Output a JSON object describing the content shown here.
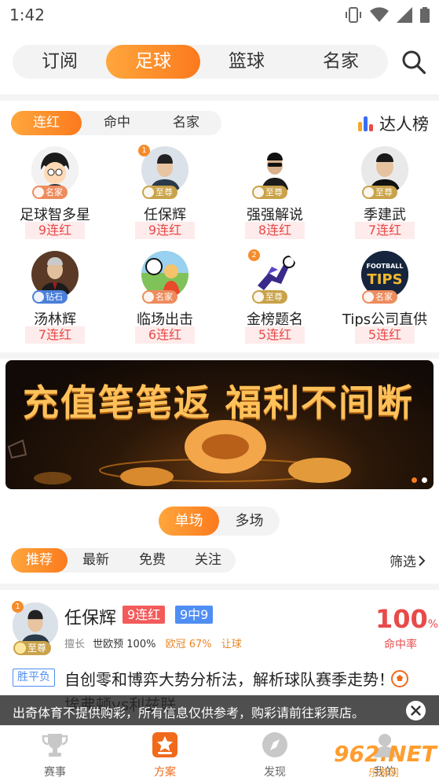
{
  "status_bar": {
    "time": "1:42"
  },
  "top_tabs": [
    {
      "label": "订阅",
      "active": false
    },
    {
      "label": "足球",
      "active": true
    },
    {
      "label": "篮球",
      "active": false
    },
    {
      "label": "名家",
      "active": false
    }
  ],
  "sub_tabs": [
    {
      "label": "连红",
      "active": true
    },
    {
      "label": "命中",
      "active": false
    },
    {
      "label": "名家",
      "active": false
    }
  ],
  "rank_link": {
    "label": "达人榜"
  },
  "experts": [
    {
      "rank": "",
      "badge": "名家",
      "badge_color": "orange",
      "name": "足球智多星",
      "streak": "9连红"
    },
    {
      "rank": "1",
      "badge": "至尊",
      "badge_color": "gold",
      "name": "任保辉",
      "streak": "9连红"
    },
    {
      "rank": "",
      "badge": "至尊",
      "badge_color": "gold",
      "name": "强强解说",
      "streak": "8连红"
    },
    {
      "rank": "",
      "badge": "至尊",
      "badge_color": "gold",
      "name": "季建武",
      "streak": "7连红"
    },
    {
      "rank": "",
      "badge": "钻石",
      "badge_color": "blue",
      "name": "汤林辉",
      "streak": "7连红"
    },
    {
      "rank": "",
      "badge": "名家",
      "badge_color": "orange",
      "name": "临场出击",
      "streak": "6连红"
    },
    {
      "rank": "2",
      "badge": "至尊",
      "badge_color": "gold",
      "name": "金榜题名",
      "streak": "5连红"
    },
    {
      "rank": "",
      "badge": "名家",
      "badge_color": "orange",
      "name": "Tips公司直供",
      "streak": "5连红",
      "avatar_text_1": "FOOTBALL",
      "avatar_text_2": "TIPS"
    }
  ],
  "banner": {
    "text": "充值笔笔返 福利不间断"
  },
  "play_toggle": [
    {
      "label": "单场",
      "active": true
    },
    {
      "label": "多场",
      "active": false
    }
  ],
  "filters": [
    {
      "label": "推荐",
      "active": true
    },
    {
      "label": "最新",
      "active": false
    },
    {
      "label": "免费",
      "active": false
    },
    {
      "label": "关注",
      "active": false
    }
  ],
  "screen_label": "筛选",
  "plan_card": {
    "rank": "1",
    "badge": "至尊",
    "name": "任保辉",
    "streak_tag": "9连红",
    "hit_tag": "9中9",
    "skills_label": "擅长",
    "skill_1": "世欧预 100%",
    "skill_2": "欧冠 67%",
    "skill_3": "让球",
    "rate_value": "100",
    "rate_unit": "%",
    "rate_label": "命中率",
    "plan_type": "胜平负",
    "title": "自创零和博弈大势分析法，解析球队赛季走势！埃弗顿vs利兹联"
  },
  "toast": {
    "text": "出奇体育不提供购彩，所有信息仅供参考，购彩请前往彩票店。"
  },
  "bottom_nav": [
    {
      "label": "赛事",
      "active": false
    },
    {
      "label": "方案",
      "active": true
    },
    {
      "label": "发现",
      "active": false
    },
    {
      "label": "我的",
      "active": false
    }
  ],
  "watermark": {
    "top": "962.NET",
    "bottom": "乐游网"
  },
  "colors": {
    "accent": "#fb7a1e",
    "streak_red": "#e84a4a",
    "hit_blue": "#4f8ef4",
    "gold": "#c9a24a"
  }
}
